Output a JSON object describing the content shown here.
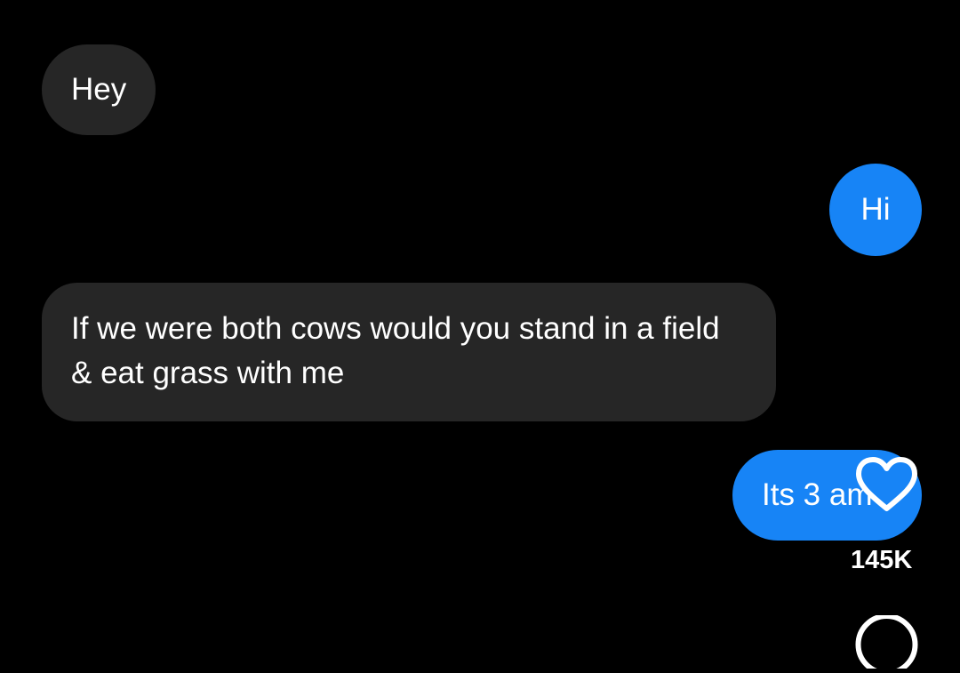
{
  "conversation": {
    "messages": [
      {
        "sender": "them",
        "text": "Hey"
      },
      {
        "sender": "me",
        "text": "Hi"
      },
      {
        "sender": "them",
        "text": "If we were both cows would you stand in a field & eat grass with me"
      },
      {
        "sender": "me",
        "text": "Its 3 am"
      }
    ]
  },
  "overlay": {
    "like_icon": "heart-outline-icon",
    "like_count": "145K",
    "comment_icon": "comment-bubble-icon"
  },
  "colors": {
    "background": "#000000",
    "incoming_bubble": "#262626",
    "outgoing_bubble": "#1784f6",
    "text": "#ffffff"
  }
}
